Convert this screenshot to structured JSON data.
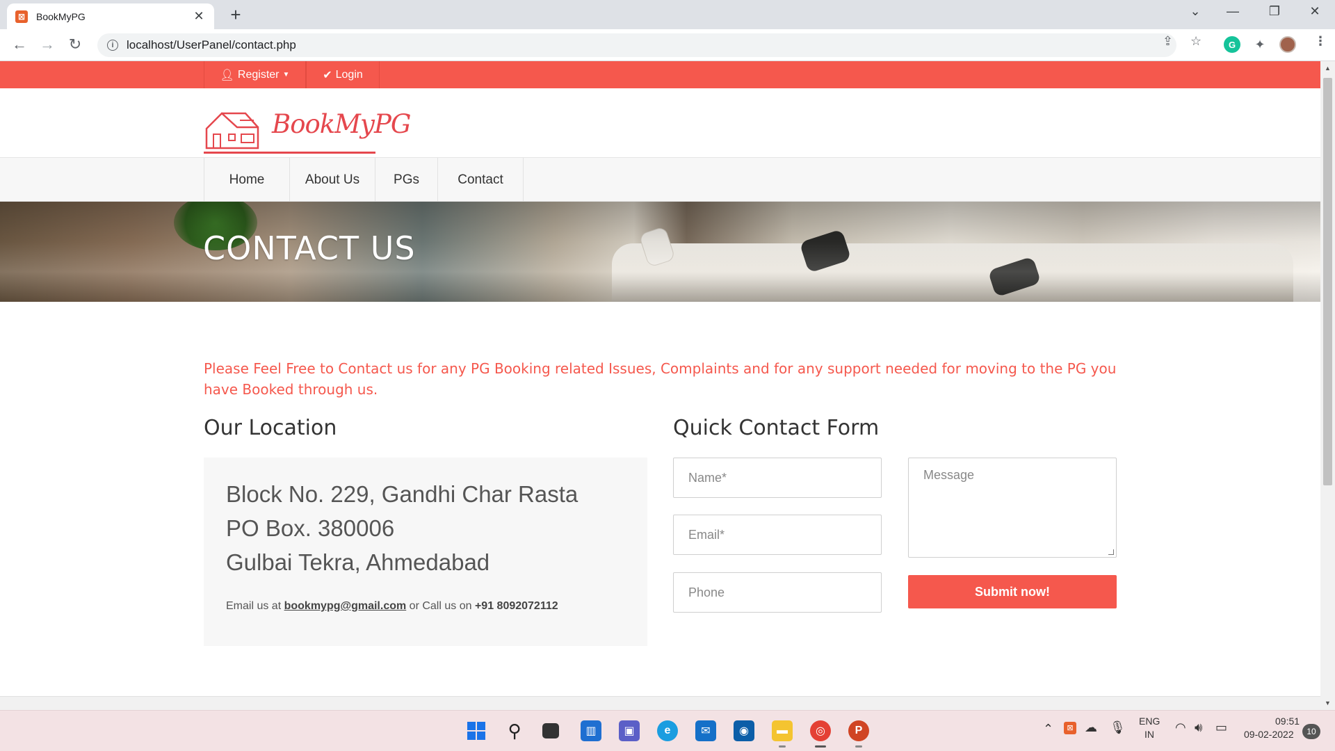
{
  "browser": {
    "tab_title": "BookMyPG",
    "tab_close": "✕",
    "new_tab": "+",
    "url": "localhost/UserPanel/contact.php"
  },
  "topbar": {
    "register": "Register",
    "login": "Login"
  },
  "logo": {
    "text": "BookMyPG"
  },
  "nav": {
    "items": [
      "Home",
      "About Us",
      "PGs",
      "Contact"
    ]
  },
  "hero": {
    "title": "CONTACT US"
  },
  "intro": "Please Feel Free to Contact us for any PG Booking related Issues, Complaints and for any support needed for moving to the PG you have Booked through us.",
  "location": {
    "heading": "Our Location",
    "lines": [
      "Block No. 229, Gandhi Char Rasta",
      "PO Box. 380006",
      "Gulbai Tekra, Ahmedabad"
    ],
    "email_prefix": "Email us at",
    "email": "bookmypg@gmail.com",
    "phone_prefix": "or Call us on",
    "phone": "+91 8092072112"
  },
  "form": {
    "heading": "Quick Contact Form",
    "name_placeholder": "Name*",
    "email_placeholder": "Email*",
    "phone_placeholder": "Phone",
    "message_placeholder": "Message",
    "submit_label": "Submit now!"
  },
  "taskbar": {
    "language": "ENG",
    "region": "IN",
    "time": "09:51",
    "date": "09-02-2022",
    "notification_count": "10"
  },
  "colors": {
    "accent": "#f5584d",
    "logo": "#e5474d"
  }
}
